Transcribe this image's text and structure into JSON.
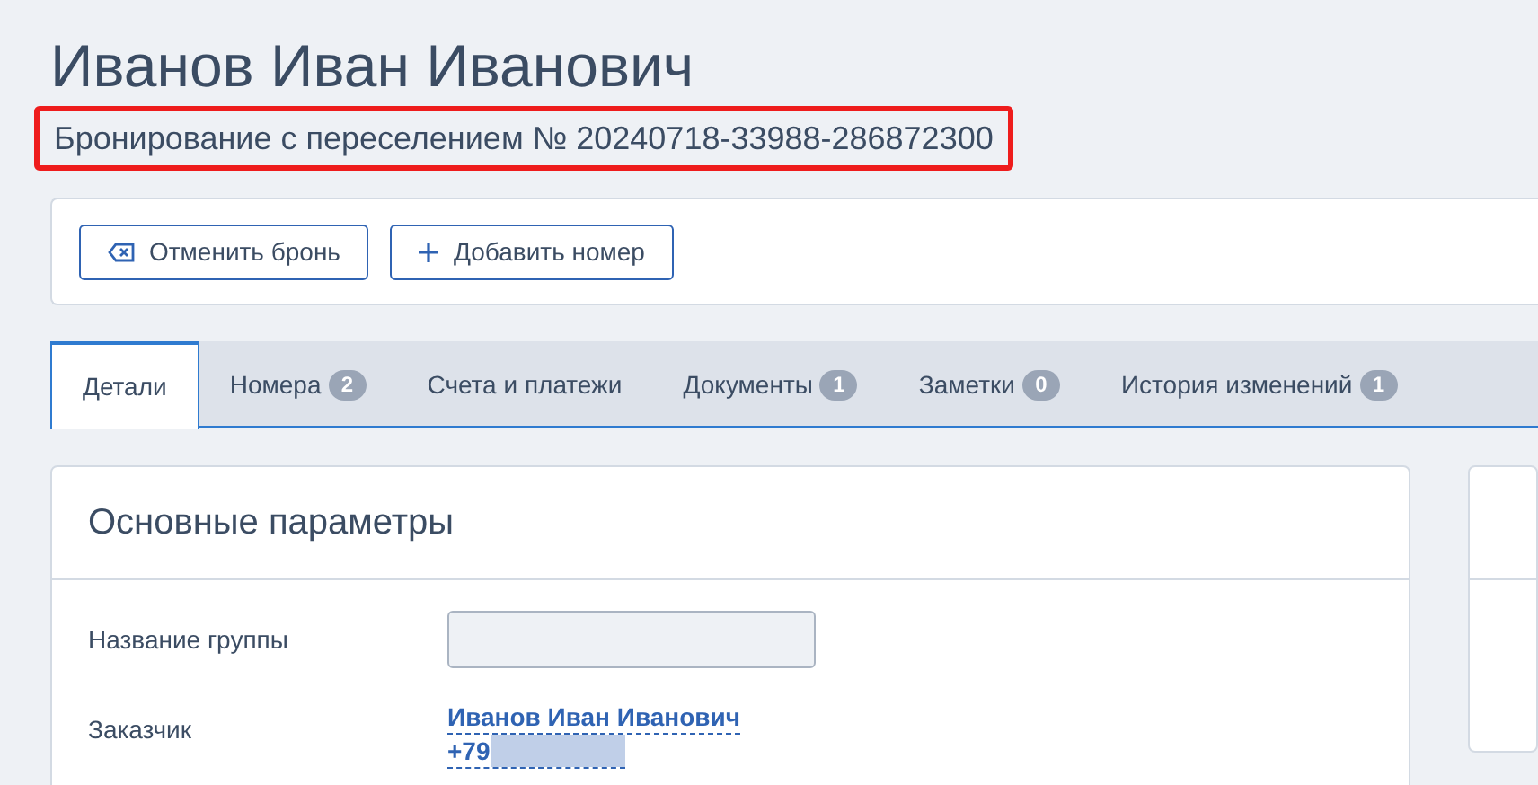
{
  "header": {
    "title": "Иванов Иван Иванович",
    "subtitle": "Бронирование с переселением № 20240718-33988-286872300",
    "subtitle_highlighted": true
  },
  "toolbar": {
    "buttons": [
      {
        "kind": "cancel",
        "label": "Отменить бронь"
      },
      {
        "kind": "add",
        "label": "Добавить номер"
      }
    ]
  },
  "tabs": [
    {
      "label": "Детали",
      "selected": true
    },
    {
      "label": "Номера",
      "count": "2",
      "selected": false
    },
    {
      "label": "Счета и платежи",
      "selected": false
    },
    {
      "label": "Документы",
      "count": "1",
      "selected": false
    },
    {
      "label": "Заметки",
      "count": "0",
      "selected": false
    },
    {
      "label": "История изменений",
      "count": "1",
      "selected": false
    }
  ],
  "main_card": {
    "title": "Основные параметры",
    "fields": [
      {
        "kind": "input",
        "label": "Название группы"
      },
      {
        "kind": "contact",
        "label": "Заказчик",
        "name": "Иванов Иван Иванович",
        "phone": "+79",
        "phone_redacted": true
      }
    ]
  }
}
